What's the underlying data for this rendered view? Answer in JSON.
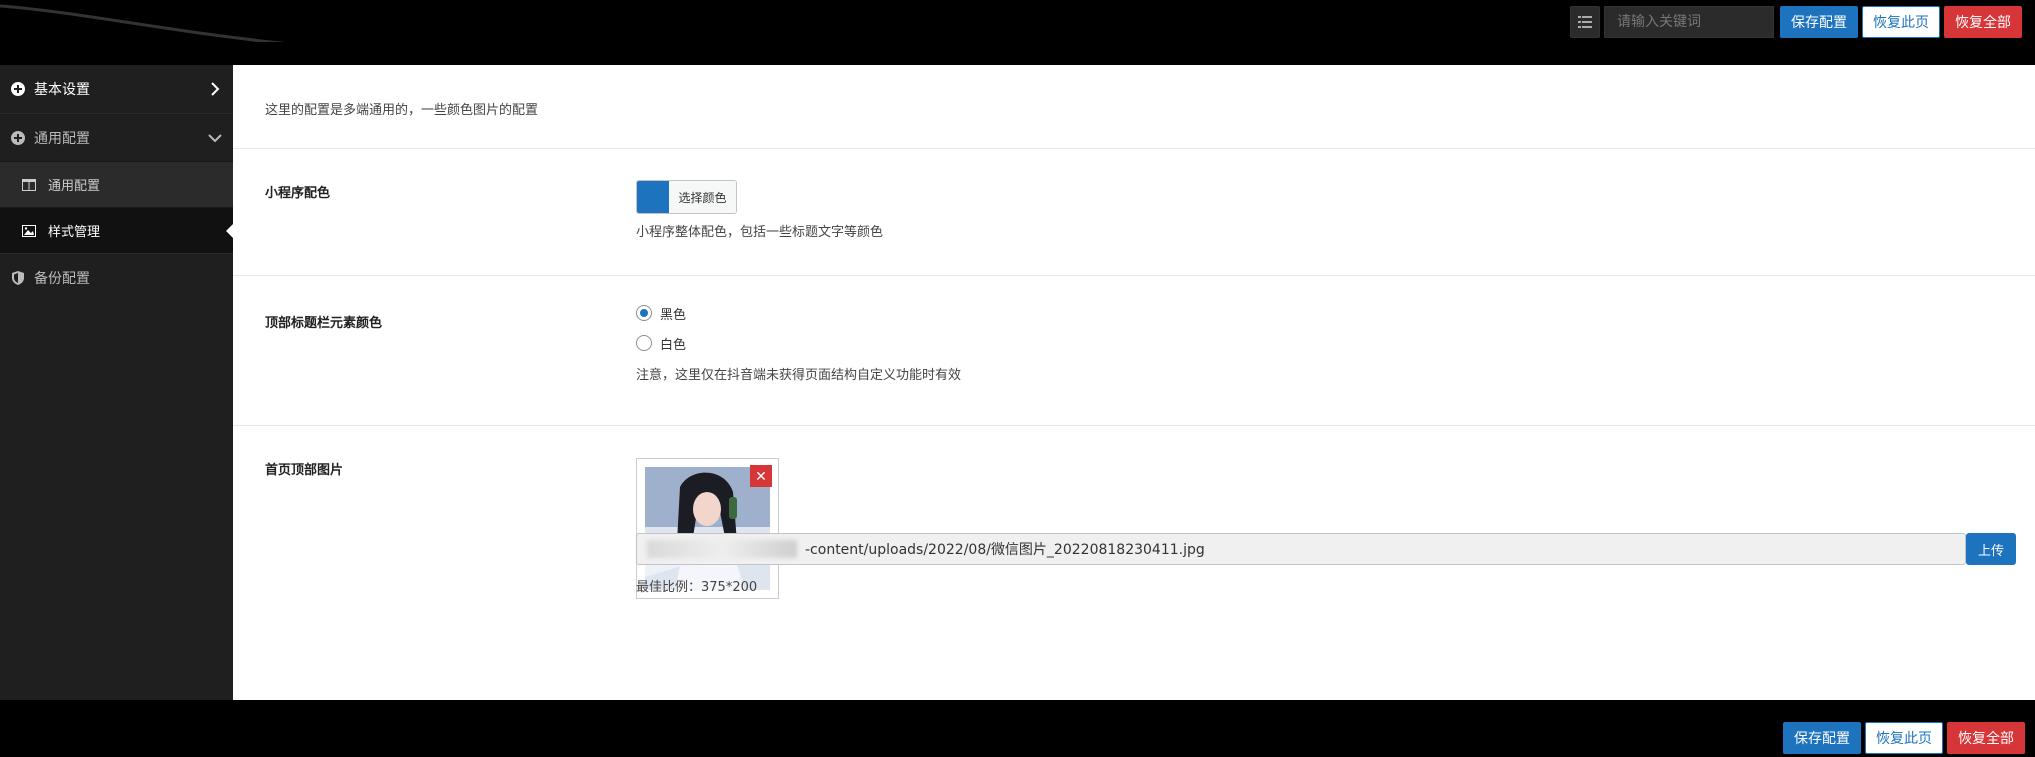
{
  "topbar": {
    "search_placeholder": "请输入关键词",
    "save_label": "保存配置",
    "restore_page_label": "恢复此页",
    "restore_all_label": "恢复全部"
  },
  "sidebar": {
    "items": [
      {
        "label": "基本设置",
        "icon": "plus-circle-icon",
        "arrow": "chevron-right-icon"
      },
      {
        "label": "通用配置",
        "icon": "plus-circle-icon",
        "arrow": "chevron-down-icon"
      },
      {
        "label": "通用配置",
        "icon": "columns-icon"
      },
      {
        "label": "样式管理",
        "icon": "image-icon",
        "active": true
      },
      {
        "label": "备份配置",
        "icon": "shield-icon"
      }
    ]
  },
  "main": {
    "intro": "这里的配置是多端通用的，一些颜色图片的配置",
    "miniapp_color": {
      "label": "小程序配色",
      "picker_label": "选择颜色",
      "value": "#1e73be",
      "hint": "小程序整体配色，包括一些标题文字等颜色"
    },
    "title_bar_color": {
      "label": "顶部标题栏元素颜色",
      "options": [
        "黑色",
        "白色"
      ],
      "selected": "黑色",
      "hint": "注意，这里仅在抖音端未获得页面结构自定义功能时有效"
    },
    "home_top_image": {
      "label": "首页顶部图片",
      "path": "-content/uploads/2022/08/微信图片_20220818230411.jpg",
      "upload_label": "上传",
      "hint": "最佳比例：375*200"
    }
  },
  "bottombar": {
    "save_label": "保存配置",
    "restore_page_label": "恢复此页",
    "restore_all_label": "恢复全部"
  },
  "colors": {
    "accent": "#1e73be",
    "danger": "#d63638",
    "sidebar_bg": "#1f1f1f"
  }
}
